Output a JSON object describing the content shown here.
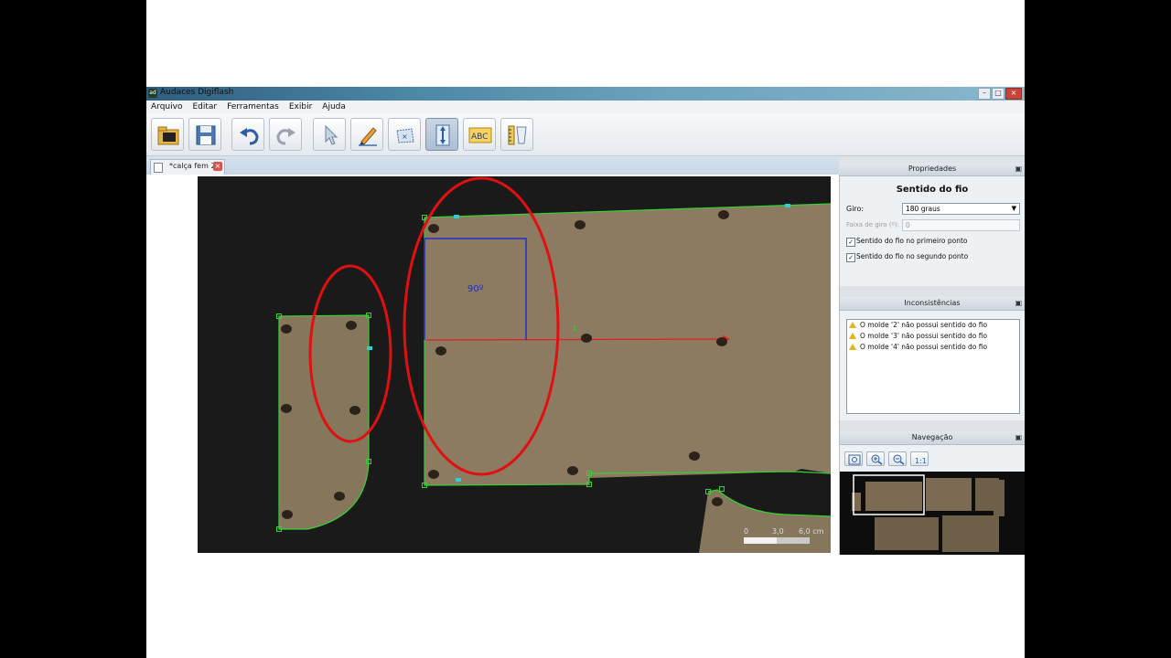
{
  "window": {
    "title": "Audaces Digiflash",
    "logo_text": "ad"
  },
  "menu": [
    "Arquivo",
    "Editar",
    "Ferramentas",
    "Exibir",
    "Ajuda"
  ],
  "tab": {
    "label": "*calça fem 2",
    "close": "×"
  },
  "canvas": {
    "angle_label": "90º",
    "point_label": "1",
    "scale": {
      "labels": [
        "0",
        "3,0",
        "6,0 cm"
      ]
    }
  },
  "properties": {
    "header": "Propriedades",
    "title": "Sentido do fio",
    "giro_label": "Giro:",
    "giro_value": "180 graus",
    "faixa_label": "Faixa de giro (º):",
    "faixa_value": "0",
    "check1_label": "Sentido do fio no primeiro ponto",
    "check1_checked": true,
    "check2_label": "Sentido do fio no segundo ponto",
    "check2_checked": true
  },
  "inconsistencies": {
    "header": "Inconsistências",
    "items": [
      "O molde '2' não possui sentido do fio",
      "O molde '3' não possui sentido do fio",
      "O molde '4' não possui sentido do fio"
    ]
  },
  "navigation": {
    "header": "Navegação"
  },
  "colors": {
    "annotation_red": "#e01010",
    "outline_green": "#35d135",
    "grain_line": "#e02020",
    "angle_box": "#2030c0"
  }
}
